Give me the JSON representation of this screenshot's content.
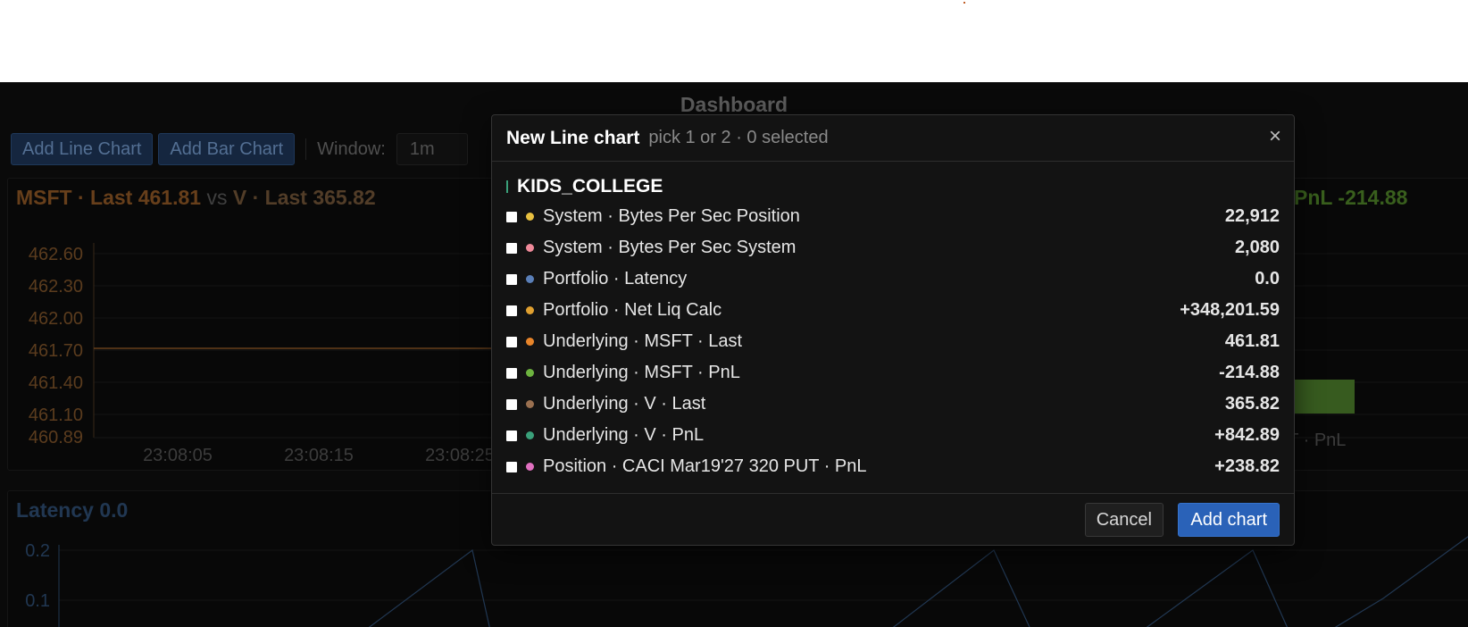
{
  "app": {
    "title": "Dashboard",
    "toolbar": {
      "add_line_label": "Add Line Chart",
      "add_bar_label": "Add Bar Chart",
      "window_label": "Window:",
      "window_value": "1m"
    }
  },
  "charts": {
    "price_chart": {
      "title_a": "MSFT · Last 461.81",
      "title_vs": "vs",
      "title_b": "V · Last 365.82",
      "y_ticks": [
        "462.60",
        "462.30",
        "462.00",
        "461.70",
        "461.40",
        "461.10",
        "460.89"
      ],
      "x_ticks": [
        "23:08:05",
        "23:08:15",
        "23:08:25"
      ],
      "line_color": "#8a5424"
    },
    "bar_chart": {
      "title": "PnL -214.88",
      "bar_label": "FT · PnL",
      "bar_color": "#4a7a2a"
    },
    "latency_chart": {
      "title": "Latency 0.0",
      "y_ticks": [
        "0.2",
        "0.1"
      ],
      "line_color": "#2c4a6e"
    }
  },
  "chart_data": [
    {
      "type": "line",
      "title": "MSFT · Last 461.81 vs V · Last 365.82",
      "x": [
        "23:08:05",
        "23:08:15",
        "23:08:25"
      ],
      "series": [
        {
          "name": "MSFT · Last",
          "values": [
            461.81,
            461.81,
            461.81
          ]
        }
      ],
      "ylim": [
        460.89,
        462.6
      ]
    },
    {
      "type": "bar",
      "title": "PnL -214.88",
      "categories": [
        "FT · PnL"
      ],
      "values": [
        -214.88
      ]
    },
    {
      "type": "line",
      "title": "Latency 0.0",
      "series": [
        {
          "name": "Latency",
          "values": [
            0.1,
            0.2,
            0.0,
            0.1,
            0.2,
            0.0,
            0.1,
            0.2,
            0.0,
            0.1
          ]
        }
      ],
      "ylim": [
        0,
        0.2
      ]
    }
  ],
  "modal": {
    "title": "New Line chart",
    "subtitle": "pick 1 or 2  ·  0 selected",
    "close_glyph": "×",
    "group_label": "KIDS_COLLEGE",
    "rows": [
      {
        "label": "System · Bytes Per Sec Position",
        "value": "22,912",
        "color": "#e8c040"
      },
      {
        "label": "System · Bytes Per Sec System",
        "value": "2,080",
        "color": "#f08a9a"
      },
      {
        "label": "Portfolio · Latency",
        "value": "0.0",
        "color": "#5a7fb8"
      },
      {
        "label": "Portfolio · Net Liq Calc",
        "value": "+348,201.59",
        "color": "#e0a030"
      },
      {
        "label": "Underlying · MSFT · Last",
        "value": "461.81",
        "color": "#e8852a"
      },
      {
        "label": "Underlying · MSFT · PnL",
        "value": "-214.88",
        "color": "#6db33f"
      },
      {
        "label": "Underlying · V · Last",
        "value": "365.82",
        "color": "#9a7050"
      },
      {
        "label": "Underlying · V · PnL",
        "value": "+842.89",
        "color": "#3aa07a"
      },
      {
        "label": "Position · CACI Mar19'27 320 PUT · PnL",
        "value": "+238.82",
        "color": "#e070c0"
      }
    ],
    "cancel_label": "Cancel",
    "add_label": "Add chart"
  }
}
